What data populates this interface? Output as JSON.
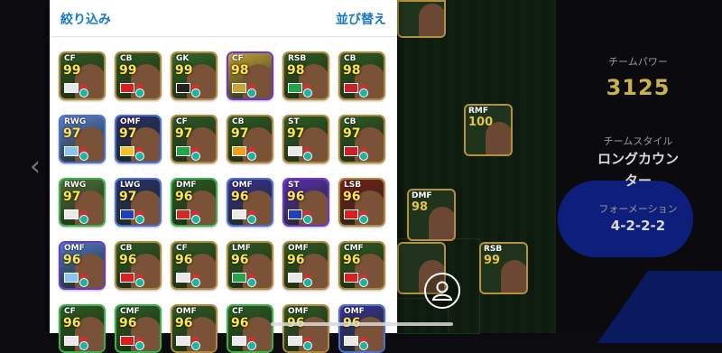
{
  "filter_panel": {
    "filter_label": "絞り込み",
    "sort_label": "並び替え",
    "cards": [
      {
        "pos": "CF",
        "ovr": "99",
        "frame": "#b08a3a",
        "bg": "#2f5a24",
        "flag": "#e9e9e9"
      },
      {
        "pos": "CB",
        "ovr": "99",
        "frame": "#b08a3a",
        "bg": "#2f5a24",
        "flag": "#d92020"
      },
      {
        "pos": "GK",
        "ovr": "99",
        "frame": "#b08a3a",
        "bg": "#35662a",
        "flag": "#222222"
      },
      {
        "pos": "CF",
        "ovr": "98",
        "frame": "#6a35d4",
        "bg": "#c7a236",
        "flag": "#c7a236"
      },
      {
        "pos": "RSB",
        "ovr": "98",
        "frame": "#b08a3a",
        "bg": "#2f5a24",
        "flag": "#23a34a"
      },
      {
        "pos": "CB",
        "ovr": "98",
        "frame": "#b08a3a",
        "bg": "#2f5a24",
        "flag": "#cc1f2d"
      },
      {
        "pos": "RWG",
        "ovr": "97",
        "frame": "#4a6fd6",
        "bg": "#5a7ed4",
        "flag": "#8ac4ef"
      },
      {
        "pos": "OMF",
        "ovr": "97",
        "frame": "#4a6fd6",
        "bg": "#2c2c6a",
        "flag": "#f0c428"
      },
      {
        "pos": "CF",
        "ovr": "97",
        "frame": "#b08a3a",
        "bg": "#2f5a24",
        "flag": "#23a34a"
      },
      {
        "pos": "CB",
        "ovr": "97",
        "frame": "#b08a3a",
        "bg": "#2f5a24",
        "flag": "#f0a020"
      },
      {
        "pos": "ST",
        "ovr": "97",
        "frame": "#b08a3a",
        "bg": "#2f5a24",
        "flag": "#e9e9e9"
      },
      {
        "pos": "CB",
        "ovr": "97",
        "frame": "#b08a3a",
        "bg": "#2f5a24",
        "flag": "#cc1f2d"
      },
      {
        "pos": "RWG",
        "ovr": "97",
        "frame": "#39b24a",
        "bg": "#4f6f3c",
        "flag": "#e9e9e9"
      },
      {
        "pos": "LWG",
        "ovr": "97",
        "frame": "#4a6fd6",
        "bg": "#2a2f6e",
        "flag": "#1f3fbf"
      },
      {
        "pos": "DMF",
        "ovr": "96",
        "frame": "#39b24a",
        "bg": "#2f5a24",
        "flag": "#d32a1f"
      },
      {
        "pos": "OMF",
        "ovr": "96",
        "frame": "#4a6fd6",
        "bg": "#3a3196",
        "flag": "#e9e9e9"
      },
      {
        "pos": "ST",
        "ovr": "96",
        "frame": "#6a35d4",
        "bg": "#5b2cb0",
        "flag": "#1f3fbf"
      },
      {
        "pos": "LSB",
        "ovr": "96",
        "frame": "#b08a3a",
        "bg": "#7a1e1e",
        "flag": "#d92020"
      },
      {
        "pos": "OMF",
        "ovr": "96",
        "frame": "#6a35d4",
        "bg": "#4f77c8",
        "flag": "#8ac4ef"
      },
      {
        "pos": "CB",
        "ovr": "96",
        "frame": "#b08a3a",
        "bg": "#2f5a24",
        "flag": "#d92020"
      },
      {
        "pos": "CF",
        "ovr": "96",
        "frame": "#b08a3a",
        "bg": "#2f5a24",
        "flag": "#e9e9e9"
      },
      {
        "pos": "LMF",
        "ovr": "96",
        "frame": "#b08a3a",
        "bg": "#2f5a24",
        "flag": "#23a34a"
      },
      {
        "pos": "OMF",
        "ovr": "96",
        "frame": "#b08a3a",
        "bg": "#2f5a24",
        "flag": "#e9e9e9"
      },
      {
        "pos": "CMF",
        "ovr": "96",
        "frame": "#b08a3a",
        "bg": "#2f5a24",
        "flag": "#d92020"
      },
      {
        "pos": "CF",
        "ovr": "96",
        "frame": "#39b24a",
        "bg": "#2f5a24",
        "flag": "#e9e9e9"
      },
      {
        "pos": "CMF",
        "ovr": "96",
        "frame": "#39b24a",
        "bg": "#2f5a24",
        "flag": "#d92020"
      },
      {
        "pos": "OMF",
        "ovr": "96",
        "frame": "#b08a3a",
        "bg": "#2f5a24",
        "flag": "#e9e9e9"
      },
      {
        "pos": "CF",
        "ovr": "96",
        "frame": "#39b24a",
        "bg": "#2f5a24",
        "flag": "#e9e9e9"
      },
      {
        "pos": "OMF",
        "ovr": "96",
        "frame": "#b08a3a",
        "bg": "#2f5a24",
        "flag": "#e9e9e9"
      },
      {
        "pos": "OMF",
        "ovr": "96",
        "frame": "#4a6fd6",
        "bg": "#3a3196",
        "flag": "#e9e9e9"
      }
    ]
  },
  "pitch_cards": [
    {
      "pos": "RMF",
      "ovr": "100",
      "frame": "#b5913b"
    },
    {
      "pos": "DMF",
      "ovr": "98",
      "frame": "#b5913b"
    },
    {
      "pos": "RSB",
      "ovr": "99",
      "frame": "#b5913b"
    }
  ],
  "team_info": {
    "power_label": "チームパワー",
    "power_value": "3125",
    "style_label": "チームスタイル",
    "style_value_line1": "ロングカウン",
    "style_value_line2": "ター",
    "formation_label": "フォーメーション",
    "formation_value": "4-2-2-2"
  },
  "icons": {
    "back": "chevron-left-icon",
    "avatar": "person-icon"
  },
  "colors": {
    "accent": "#1778c8",
    "power": "#c8b24a"
  }
}
